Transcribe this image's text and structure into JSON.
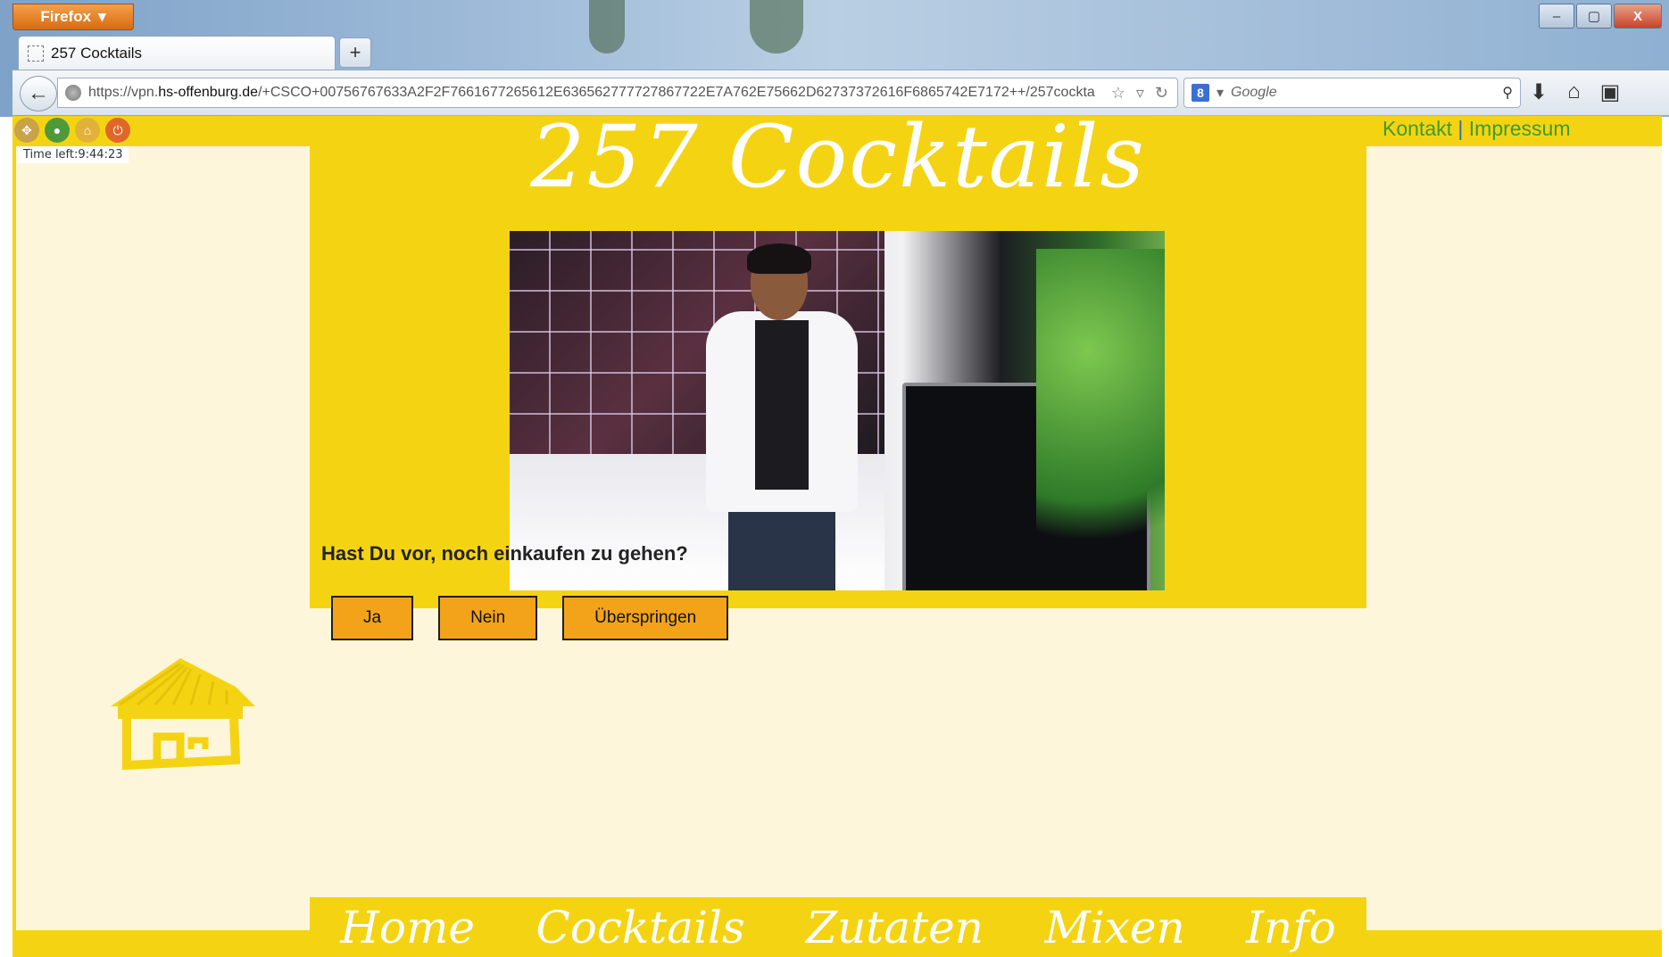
{
  "browser": {
    "app_button": "Firefox",
    "tab_title": "257 Cocktails",
    "new_tab_label": "+",
    "url_prefix": "https://vpn.",
    "url_domain": "hs-offenburg.de",
    "url_rest": "/+CSCO+00756767633A2F2F7661677265612E636562777727867722E7A762E75662D62737372616F6865742E7172++/257cockta",
    "search_placeholder": "Google",
    "window_buttons": {
      "minimize": "–",
      "maximize": "▢",
      "close": "X"
    }
  },
  "vpn": {
    "time_left": "Time left:9:44:23"
  },
  "header": {
    "links": {
      "kontakt": "Kontakt",
      "separator": "|",
      "impressum": "Impressum"
    },
    "site_title": "257 Cocktails"
  },
  "main": {
    "question": "Hast Du vor, noch einkaufen zu gehen?",
    "answers": {
      "yes": "Ja",
      "no": "Nein",
      "skip": "Überspringen"
    }
  },
  "nav": {
    "home": "Home",
    "cocktails": "Cocktails",
    "zutaten": "Zutaten",
    "mixen": "Mixen",
    "info": "Info"
  },
  "colors": {
    "brand_yellow": "#f4d412",
    "page_cream": "#fdf6da",
    "button_orange": "#f3a31a",
    "link_green": "#3d9b2f"
  }
}
